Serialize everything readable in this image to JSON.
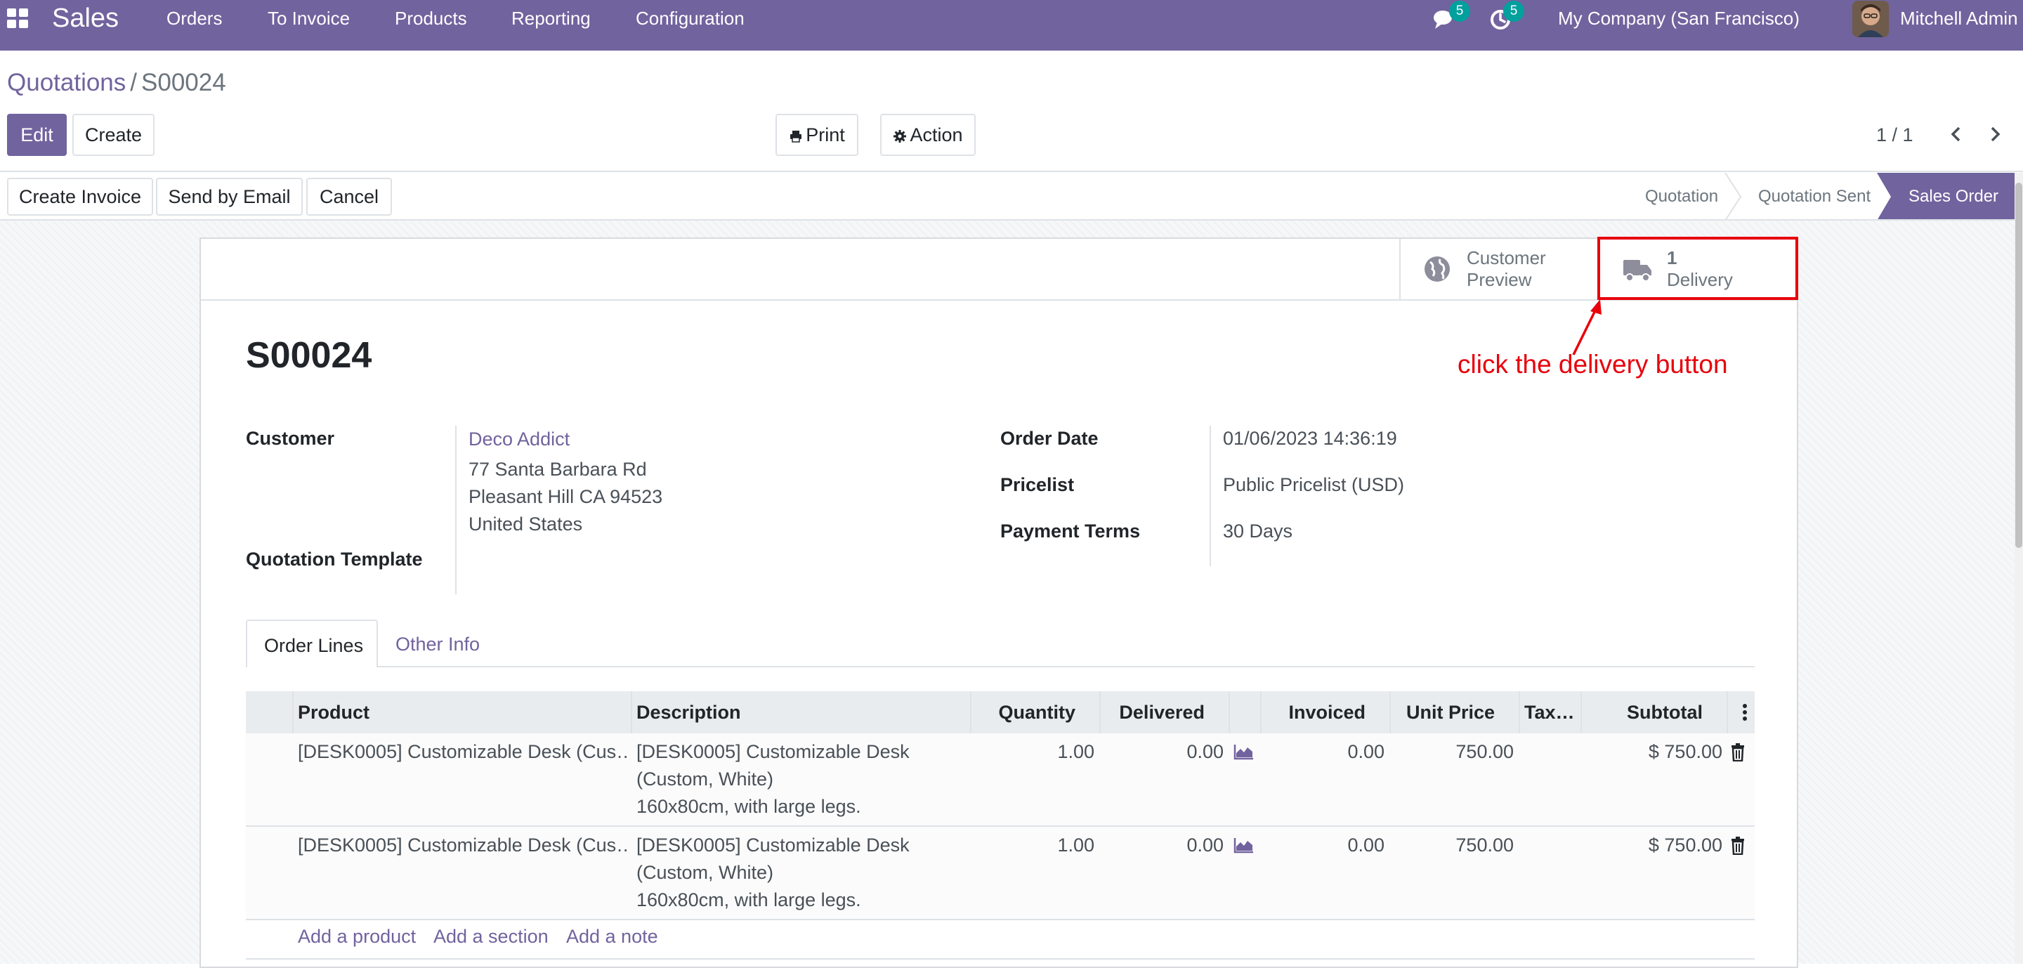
{
  "navbar": {
    "app_name": "Sales",
    "menu": [
      "Orders",
      "To Invoice",
      "Products",
      "Reporting",
      "Configuration"
    ],
    "messages_count": "5",
    "activities_count": "5",
    "company": "My Company (San Francisco)",
    "user": "Mitchell Admin"
  },
  "breadcrumb": {
    "parent": "Quotations",
    "separator": "/",
    "current": "S00024"
  },
  "buttons": {
    "edit": "Edit",
    "create": "Create",
    "print": "Print",
    "action": "Action"
  },
  "pager": {
    "text": "1 / 1"
  },
  "header_buttons": {
    "create_invoice": "Create Invoice",
    "send_by_email": "Send by Email",
    "cancel": "Cancel"
  },
  "statusbar": {
    "stages": [
      "Quotation",
      "Quotation Sent",
      "Sales Order"
    ],
    "active": "Sales Order"
  },
  "smart_buttons": {
    "customer_preview": {
      "line1": "Customer",
      "line2": "Preview"
    },
    "delivery": {
      "count": "1",
      "label": "Delivery"
    }
  },
  "record": {
    "name": "S00024",
    "customer_label": "Customer",
    "customer": "Deco Addict",
    "address": [
      "77 Santa Barbara Rd",
      "Pleasant Hill CA 94523",
      "United States"
    ],
    "quotation_template_label": "Quotation Template",
    "order_date_label": "Order Date",
    "order_date": "01/06/2023 14:36:19",
    "pricelist_label": "Pricelist",
    "pricelist": "Public Pricelist (USD)",
    "payment_terms_label": "Payment Terms",
    "payment_terms": "30 Days"
  },
  "tabs": [
    "Order Lines",
    "Other Info"
  ],
  "table": {
    "headers": {
      "product": "Product",
      "description": "Description",
      "quantity": "Quantity",
      "delivered": "Delivered",
      "invoiced": "Invoiced",
      "unit_price": "Unit Price",
      "taxes": "Tax…",
      "subtotal": "Subtotal"
    },
    "rows": [
      {
        "product": "[DESK0005] Customizable Desk (Cus…",
        "description": [
          "[DESK0005] Customizable Desk",
          "(Custom, White)",
          "160x80cm, with large legs."
        ],
        "quantity": "1.00",
        "delivered": "0.00",
        "invoiced": "0.00",
        "unit_price": "750.00",
        "subtotal": "$ 750.00"
      },
      {
        "product": "[DESK0005] Customizable Desk (Cus…",
        "description": [
          "[DESK0005] Customizable Desk",
          "(Custom, White)",
          "160x80cm, with large legs."
        ],
        "quantity": "1.00",
        "delivered": "0.00",
        "invoiced": "0.00",
        "unit_price": "750.00",
        "subtotal": "$ 750.00"
      }
    ],
    "add_links": [
      "Add a product",
      "Add a section",
      "Add a note"
    ]
  },
  "annotation": {
    "text": "click the delivery button",
    "color": "#e8000b"
  },
  "colors": {
    "brand": "#71639e",
    "badge": "#00a09d",
    "annotation": "#e8000b"
  }
}
